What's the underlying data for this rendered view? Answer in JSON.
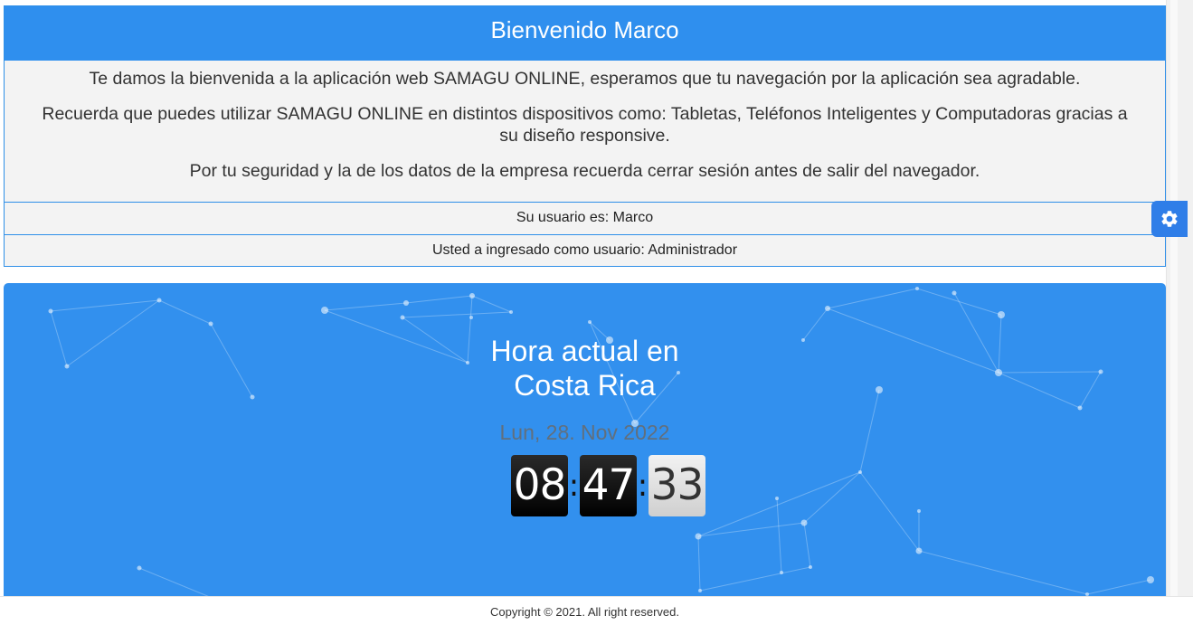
{
  "welcome": {
    "title": "Bienvenido Marco",
    "paragraphs": [
      "Te damos la bienvenida a la aplicación web SAMAGU ONLINE, esperamos que tu navegación por la aplicación sea agradable.",
      "Recuerda que puedes utilizar SAMAGU ONLINE en distintos dispositivos como: Tabletas, Teléfonos Inteligentes y Computadoras gracias a su diseño responsive.",
      "Por tu seguridad y la de los datos de la empresa recuerda cerrar sesión antes de salir del navegador."
    ],
    "user_line": "Su usuario es: Marco",
    "role_line": "Usted a ingresado como usuario: Administrador"
  },
  "settings": {
    "icon": "gear-icon",
    "color": "#2f7ee8"
  },
  "clock": {
    "title_line1": "Hora actual en",
    "title_line2": "Costa Rica",
    "date": "Lun, 28. Nov 2022",
    "hours": "08",
    "minutes": "47",
    "seconds": "33",
    "separator": ":"
  },
  "colors": {
    "primary": "#2f8fee",
    "panel_bg": "#3290ee",
    "card_bg": "#f3f3f3"
  },
  "footer": {
    "copyright": "Copyright © 2021. All right reserved."
  }
}
